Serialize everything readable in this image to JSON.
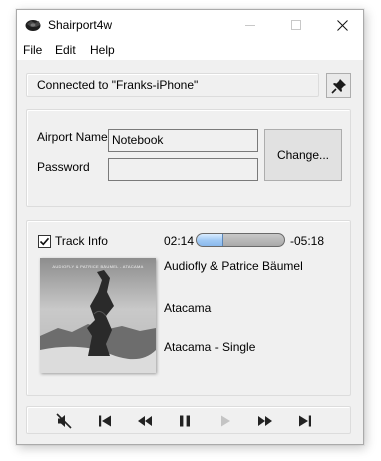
{
  "window": {
    "title": "Shairport4w"
  },
  "menu": {
    "file": "File",
    "edit": "Edit",
    "help": "Help"
  },
  "status": {
    "text": "Connected to \"Franks-iPhone\""
  },
  "airport": {
    "name_label": "Airport Name",
    "name_value": "Notebook",
    "password_label": "Password",
    "password_value": "",
    "change_label": "Change..."
  },
  "track": {
    "checkbox_label": "Track Info",
    "checked": true,
    "elapsed": "02:14",
    "remaining": "-05:18",
    "progress_fraction": 0.3,
    "artist": "Audiofly & Patrice Bäumel",
    "title": "Atacama",
    "album": "Atacama - Single",
    "cover_text": "AUDIOFLY & PATRICE BÄUMEL - ATACAMA"
  },
  "controls": [
    "mute-icon",
    "previous-icon",
    "rewind-icon",
    "pause-icon",
    "play-icon",
    "fast-forward-icon",
    "next-icon"
  ],
  "colors": {
    "titlebar": "#ffffff",
    "window_bg": "#f0f0f0",
    "progress_fill": "#9fc8f4",
    "disabled_icon": "#c4c4c4"
  }
}
